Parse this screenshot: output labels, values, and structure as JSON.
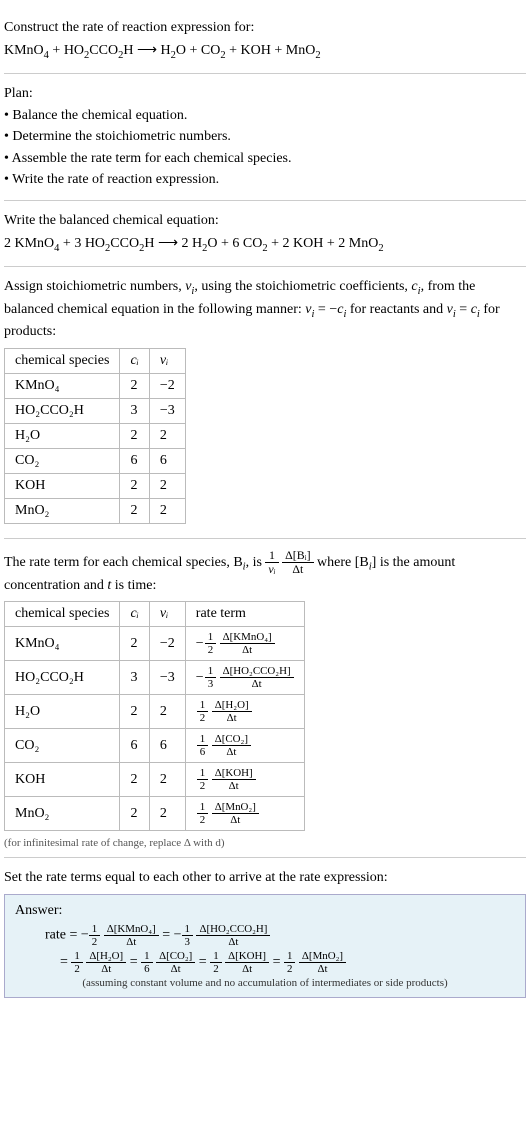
{
  "prompt": {
    "title": "Construct the rate of reaction expression for:",
    "lhs": "KMnO",
    "lhs_sub1": "4",
    "plus1": " + HO",
    "lhs_sub2": "2",
    "cco": "CCO",
    "lhs_sub3": "2",
    "h_end": "H ",
    "arrow": "⟶",
    "rhs": "  H",
    "rhs_sub1": "2",
    "o_plus": "O + CO",
    "rhs_sub2": "2",
    "plus_koh": " + KOH + MnO",
    "rhs_sub3": "2"
  },
  "plan": {
    "title": "Plan:",
    "b1": "• Balance the chemical equation.",
    "b2": "• Determine the stoichiometric numbers.",
    "b3": "• Assemble the rate term for each chemical species.",
    "b4": "• Write the rate of reaction expression."
  },
  "balanced": {
    "title": "Write the balanced chemical equation:",
    "c1": "2 KMnO",
    "s1": "4",
    "p1": " + 3 HO",
    "s2": "2",
    "cco": "CCO",
    "s3": "2",
    "h": "H ",
    "arrow": "⟶",
    "c2": "  2 H",
    "s4": "2",
    "o": "O + 6 CO",
    "s5": "2",
    "koh": " + 2 KOH + 2 MnO",
    "s6": "2"
  },
  "assign": {
    "p1": "Assign stoichiometric numbers, ",
    "nu": "ν",
    "sub_i1": "i",
    "p2": ", using the stoichiometric coefficients, ",
    "c": "c",
    "sub_i2": "i",
    "p3": ", from the balanced chemical equation in the following manner: ",
    "nu2": "ν",
    "sub_i3": "i",
    "eq": " = −",
    "c2": "c",
    "sub_i4": "i",
    "p4": " for reactants and ",
    "nu3": "ν",
    "sub_i5": "i",
    "eq2": " = ",
    "c3": "c",
    "sub_i6": "i",
    "p5": " for products:"
  },
  "table1": {
    "h1": "chemical species",
    "h2": "cᵢ",
    "h3": "νᵢ",
    "r1c1": "KMnO₄",
    "r1c2": "2",
    "r1c3": "−2",
    "r2c1": "HO₂CCO₂H",
    "r2c2": "3",
    "r2c3": "−3",
    "r3c1": "H₂O",
    "r3c2": "2",
    "r3c3": "2",
    "r4c1": "CO₂",
    "r4c2": "6",
    "r4c3": "6",
    "r5c1": "KOH",
    "r5c2": "2",
    "r5c3": "2",
    "r6c1": "MnO₂",
    "r6c2": "2",
    "r6c3": "2"
  },
  "rateterm_intro": {
    "p1": "The rate term for each chemical species, B",
    "sub_i": "i",
    "p2": ", is ",
    "frac1_num": "1",
    "frac1_den": "νᵢ",
    "frac2_num": "Δ[Bᵢ]",
    "frac2_den": "Δt",
    "p3": " where [B",
    "sub_i2": "i",
    "p4": "] is the amount concentration and ",
    "t": "t",
    "p5": " is time:"
  },
  "table2": {
    "h1": "chemical species",
    "h2": "cᵢ",
    "h3": "νᵢ",
    "h4": "rate term",
    "r1c1": "KMnO₄",
    "r1c2": "2",
    "r1c3": "−2",
    "r1_coef_num": "1",
    "r1_coef_den": "2",
    "r1_neg": "−",
    "r1_dnum": "Δ[KMnO₄]",
    "r1_dden": "Δt",
    "r2c1": "HO₂CCO₂H",
    "r2c2": "3",
    "r2c3": "−3",
    "r2_coef_num": "1",
    "r2_coef_den": "3",
    "r2_neg": "−",
    "r2_dnum": "Δ[HO₂CCO₂H]",
    "r2_dden": "Δt",
    "r3c1": "H₂O",
    "r3c2": "2",
    "r3c3": "2",
    "r3_coef_num": "1",
    "r3_coef_den": "2",
    "r3_neg": "",
    "r3_dnum": "Δ[H₂O]",
    "r3_dden": "Δt",
    "r4c1": "CO₂",
    "r4c2": "6",
    "r4c3": "6",
    "r4_coef_num": "1",
    "r4_coef_den": "6",
    "r4_neg": "",
    "r4_dnum": "Δ[CO₂]",
    "r4_dden": "Δt",
    "r5c1": "KOH",
    "r5c2": "2",
    "r5c3": "2",
    "r5_coef_num": "1",
    "r5_coef_den": "2",
    "r5_neg": "",
    "r5_dnum": "Δ[KOH]",
    "r5_dden": "Δt",
    "r6c1": "MnO₂",
    "r6c2": "2",
    "r6c3": "2",
    "r6_coef_num": "1",
    "r6_coef_den": "2",
    "r6_neg": "",
    "r6_dnum": "Δ[MnO₂]",
    "r6_dden": "Δt"
  },
  "table2_note": "(for infinitesimal rate of change, replace Δ with d)",
  "set_equal": "Set the rate terms equal to each other to arrive at the rate expression:",
  "answer": {
    "title": "Answer:",
    "rate_eq": "rate = ",
    "neg": "−",
    "f1_num": "1",
    "f1_den": "2",
    "d1_num": "Δ[KMnO₄]",
    "d1_den": "Δt",
    "eq1": " = ",
    "f2_num": "1",
    "f2_den": "3",
    "d2_num": "Δ[HO₂CCO₂H]",
    "d2_den": "Δt",
    "eq2": " = ",
    "f3_num": "1",
    "f3_den": "2",
    "d3_num": "Δ[H₂O]",
    "d3_den": "Δt",
    "eq3": " = ",
    "f4_num": "1",
    "f4_den": "6",
    "d4_num": "Δ[CO₂]",
    "d4_den": "Δt",
    "eq4": " = ",
    "f5_num": "1",
    "f5_den": "2",
    "d5_num": "Δ[KOH]",
    "d5_den": "Δt",
    "eq5": " = ",
    "f6_num": "1",
    "f6_den": "2",
    "d6_num": "Δ[MnO₂]",
    "d6_den": "Δt",
    "note": "(assuming constant volume and no accumulation of intermediates or side products)"
  }
}
